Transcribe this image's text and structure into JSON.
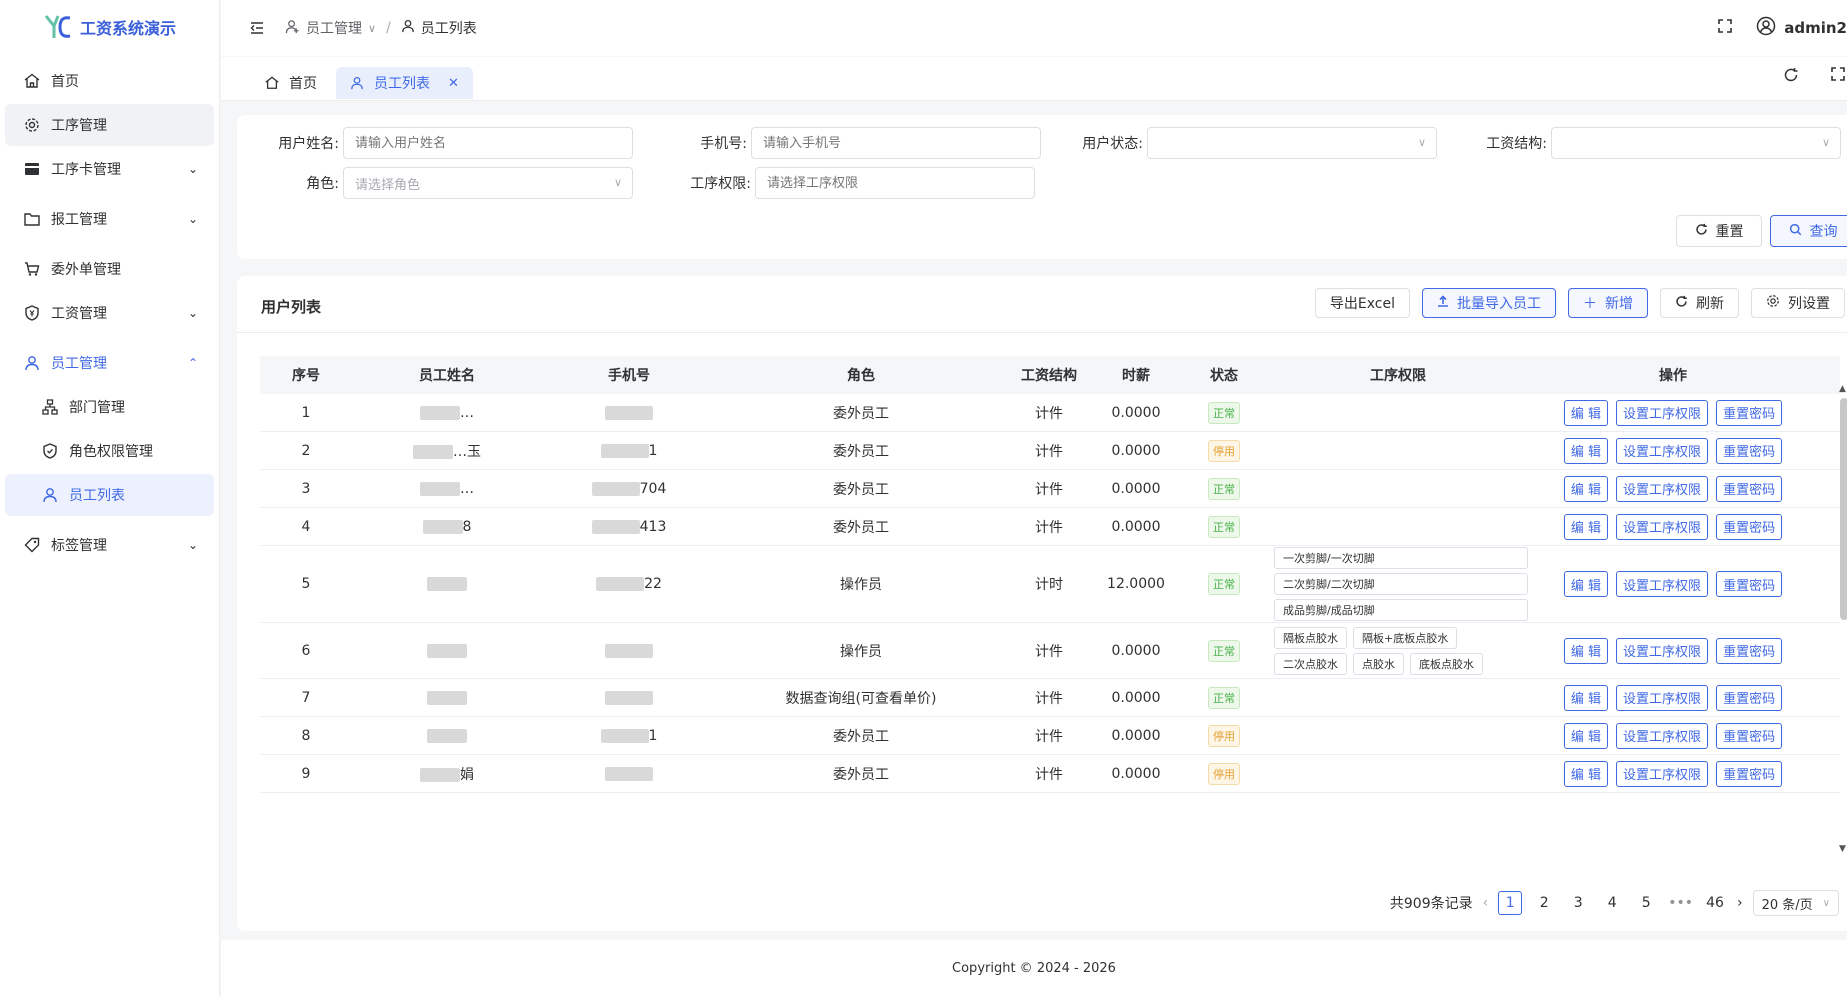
{
  "app": {
    "title": "工资系统演示",
    "accent": "#4069e5"
  },
  "sidebar": {
    "items": [
      {
        "label": "首页",
        "icon": "home-icon"
      },
      {
        "label": "工序管理",
        "icon": "gear-icon"
      },
      {
        "label": "工序卡管理",
        "icon": "card-icon"
      },
      {
        "label": "报工管理",
        "icon": "folder-icon"
      },
      {
        "label": "委外单管理",
        "icon": "cart-icon"
      },
      {
        "label": "工资管理",
        "icon": "yen-shield-icon"
      },
      {
        "label": "员工管理",
        "icon": "user-icon"
      },
      {
        "label": "部门管理",
        "icon": "org-icon"
      },
      {
        "label": "角色权限管理",
        "icon": "shield-icon"
      },
      {
        "label": "员工列表",
        "icon": "user-icon"
      },
      {
        "label": "标签管理",
        "icon": "tag-icon"
      }
    ]
  },
  "header": {
    "breadcrumb_parent": "员工管理",
    "breadcrumb_current": "员工列表",
    "user": "admin2"
  },
  "tabs": {
    "home": "首页",
    "active": "员工列表"
  },
  "search": {
    "username_label": "用户姓名:",
    "username_placeholder": "请输入用户姓名",
    "phone_label": "手机号:",
    "phone_placeholder": "请输入手机号",
    "status_label": "用户状态:",
    "salary_label": "工资结构:",
    "role_label": "角色:",
    "role_placeholder": "请选择角色",
    "perm_label": "工序权限:",
    "perm_placeholder": "请选择工序权限",
    "reset": "重置",
    "query": "查询"
  },
  "table_panel": {
    "title": "用户列表",
    "export": "导出Excel",
    "import": "批量导入员工",
    "add": "新增",
    "refresh": "刷新",
    "columns_setting": "列设置"
  },
  "columns": [
    "序号",
    "员工姓名",
    "手机号",
    "角色",
    "工资结构",
    "时薪",
    "状态",
    "工序权限",
    "操作"
  ],
  "rows": [
    {
      "no": "1",
      "name": "…",
      "phone": "",
      "role": "委外员工",
      "salary": "计件",
      "rate": "0.0000",
      "status": "正常",
      "status_type": "ok",
      "perms": []
    },
    {
      "no": "2",
      "name": "…玉",
      "phone": "1",
      "role": "委外员工",
      "salary": "计件",
      "rate": "0.0000",
      "status": "停用",
      "status_type": "off",
      "perms": []
    },
    {
      "no": "3",
      "name": "…",
      "phone": "704",
      "role": "委外员工",
      "salary": "计件",
      "rate": "0.0000",
      "status": "正常",
      "status_type": "ok",
      "perms": []
    },
    {
      "no": "4",
      "name": "8",
      "phone": "413",
      "role": "委外员工",
      "salary": "计件",
      "rate": "0.0000",
      "status": "正常",
      "status_type": "ok",
      "perms": []
    },
    {
      "no": "5",
      "name": "",
      "phone": "22",
      "role": "操作员",
      "salary": "计时",
      "rate": "12.0000",
      "status": "正常",
      "status_type": "ok",
      "perms": [
        "一次剪脚/一次切脚",
        "二次剪脚/二次切脚",
        "成品剪脚/成品切脚"
      ]
    },
    {
      "no": "6",
      "name": "",
      "phone": "",
      "role": "操作员",
      "salary": "计件",
      "rate": "0.0000",
      "status": "正常",
      "status_type": "ok",
      "perms": [
        "隔板点胶水",
        "隔板+底板点胶水",
        "二次点胶水",
        "点胶水",
        "底板点胶水"
      ]
    },
    {
      "no": "7",
      "name": "",
      "phone": "",
      "role": "数据查询组(可查看单价)",
      "salary": "计件",
      "rate": "0.0000",
      "status": "正常",
      "status_type": "ok",
      "perms": []
    },
    {
      "no": "8",
      "name": "",
      "phone": "1",
      "role": "委外员工",
      "salary": "计件",
      "rate": "0.0000",
      "status": "停用",
      "status_type": "off",
      "perms": []
    },
    {
      "no": "9",
      "name": "娟",
      "phone": "",
      "role": "委外员工",
      "salary": "计件",
      "rate": "0.0000",
      "status": "停用",
      "status_type": "off",
      "perms": []
    }
  ],
  "ops": {
    "edit": "编 辑",
    "set_perm": "设置工序权限",
    "reset_pwd": "重置密码"
  },
  "pagination": {
    "total": "共909条记录",
    "pages": [
      "1",
      "2",
      "3",
      "4",
      "5"
    ],
    "ellipsis": "•••",
    "last": "46",
    "page_size": "20 条/页"
  },
  "footer": "Copyright © 2024 - 2026"
}
